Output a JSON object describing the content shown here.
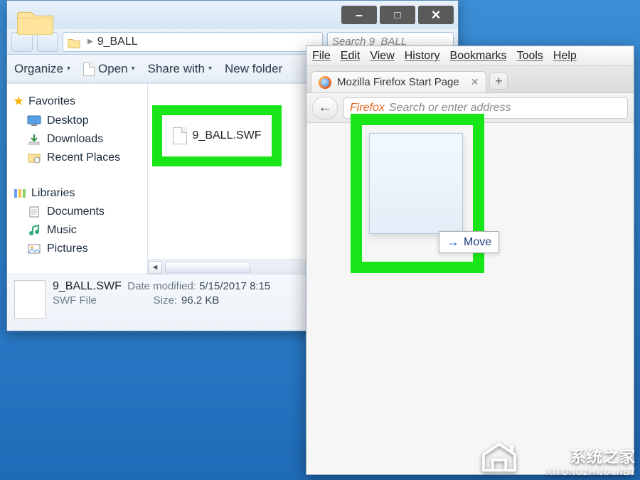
{
  "explorer": {
    "address_path": "9_BALL",
    "search_placeholder": "Search 9_BALL",
    "toolbar": {
      "organize": "Organize",
      "open": "Open",
      "share": "Share with",
      "new_folder": "New folder"
    },
    "sidebar": {
      "favorites_label": "Favorites",
      "favorites": [
        "Desktop",
        "Downloads",
        "Recent Places"
      ],
      "libraries_label": "Libraries",
      "libraries": [
        "Documents",
        "Music",
        "Pictures"
      ]
    },
    "file_name": "9_BALL.SWF",
    "details": {
      "name": "9_BALL.SWF",
      "type": "SWF File",
      "modified_label": "Date modified:",
      "modified_value": "5/15/2017 8:15",
      "size_label": "Size:",
      "size_value": "96.2 KB"
    }
  },
  "firefox": {
    "menubar": [
      "File",
      "Edit",
      "View",
      "History",
      "Bookmarks",
      "Tools",
      "Help"
    ],
    "tab_title": "Mozilla Firefox Start Page",
    "url_brand": "Firefox",
    "url_placeholder": "Search or enter address",
    "move_label": "Move"
  },
  "watermark": {
    "cn": "系统之家",
    "url": "XITONGZHIJIA.NET"
  }
}
